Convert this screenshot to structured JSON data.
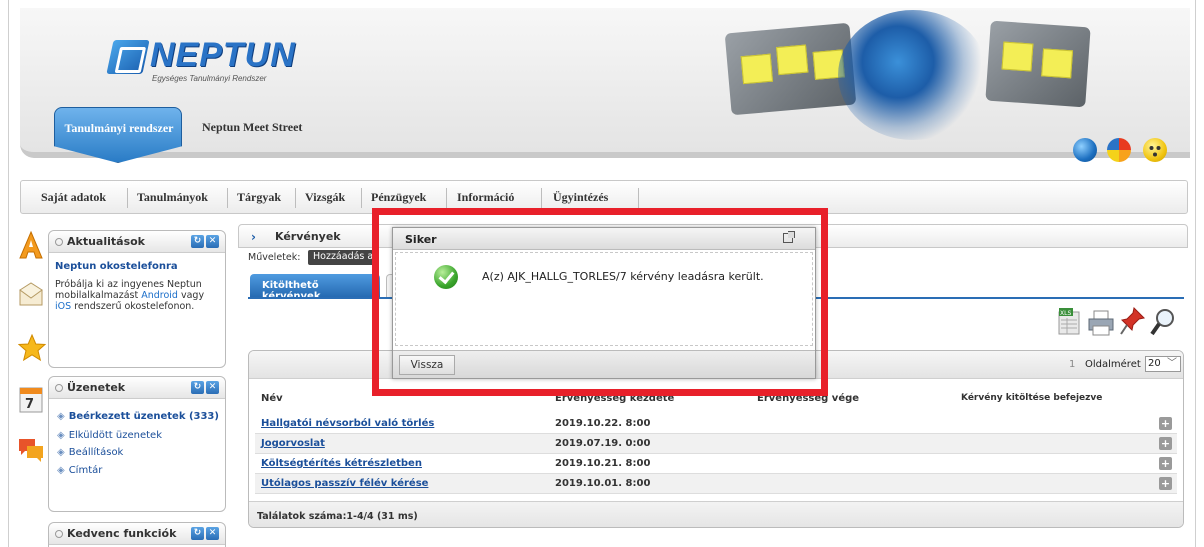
{
  "header": {
    "logo_text": "NEPTUN",
    "logo_sub": "Egységes Tanulmányi Rendszer",
    "tab_active": "Tanulmányi rendszer",
    "tab_other": "Neptun Meet Street",
    "icons": [
      "globe-icon",
      "pie-chart-icon",
      "face-icon"
    ]
  },
  "mainmenu": {
    "items": [
      "Saját adatok",
      "Tanulmányok",
      "Tárgyak",
      "Vizsgák",
      "Pénzügyek",
      "Információ",
      "Ügyintézés"
    ]
  },
  "left_icons": [
    "news-icon",
    "mail-icon",
    "star-icon",
    "calendar-icon",
    "chat-icon"
  ],
  "calendar_day": "7",
  "news_box": {
    "title": "Aktualitások",
    "news_title": "Neptun okostelefonra",
    "body_1": "Próbálja ki az ingyenes Neptun mobilalkalmazást ",
    "link_android": "Android",
    "body_2": " vagy ",
    "link_ios": "iOS",
    "body_3": " rendszerű okostelefonon."
  },
  "messages_box": {
    "title": "Üzenetek",
    "items": [
      "Beérkezett üzenetek (333)",
      "Elküldött üzenetek",
      "Beállítások",
      "Címtár"
    ]
  },
  "favorites_box": {
    "title": "Kedvenc funkciók"
  },
  "content": {
    "title": "Kérvények",
    "operations_label": "Műveletek:",
    "operation_button": "Hozzáadás a ",
    "tab_active": "Kitölthető kérvények",
    "tool_icons": [
      "xls-icon",
      "print-icon",
      "pin-icon",
      "search-icon"
    ]
  },
  "grid": {
    "page_number": "1",
    "page_size_label": "Oldalméret",
    "page_size_value": "20",
    "columns": [
      "Név",
      "Érvényesség kezdete",
      "Érvényesség vége",
      "Kérvény kitöltése befejezve"
    ],
    "rows": [
      {
        "name": "Hallgatói névsorból való törlés",
        "start": "2019.10.22. 8:00"
      },
      {
        "name": "Jogorvoslat",
        "start": "2019.07.19. 0:00"
      },
      {
        "name": "Költségtérítés  kétrészletben",
        "start": "2019.10.21. 8:00"
      },
      {
        "name": "Utólagos passzív félév kérése",
        "start": "2019.10.01. 8:00"
      }
    ],
    "footer": "Találatok száma:1-4/4 (31 ms)"
  },
  "dialog": {
    "title": "Siker",
    "message": "A(z) AJK_HALLG_TORLES/7 kérvény leadásra került.",
    "back_button": "Vissza"
  },
  "colors": {
    "highlight": "#e8202a",
    "brand_blue": "#2a73c6",
    "link": "#1b4f9a"
  }
}
